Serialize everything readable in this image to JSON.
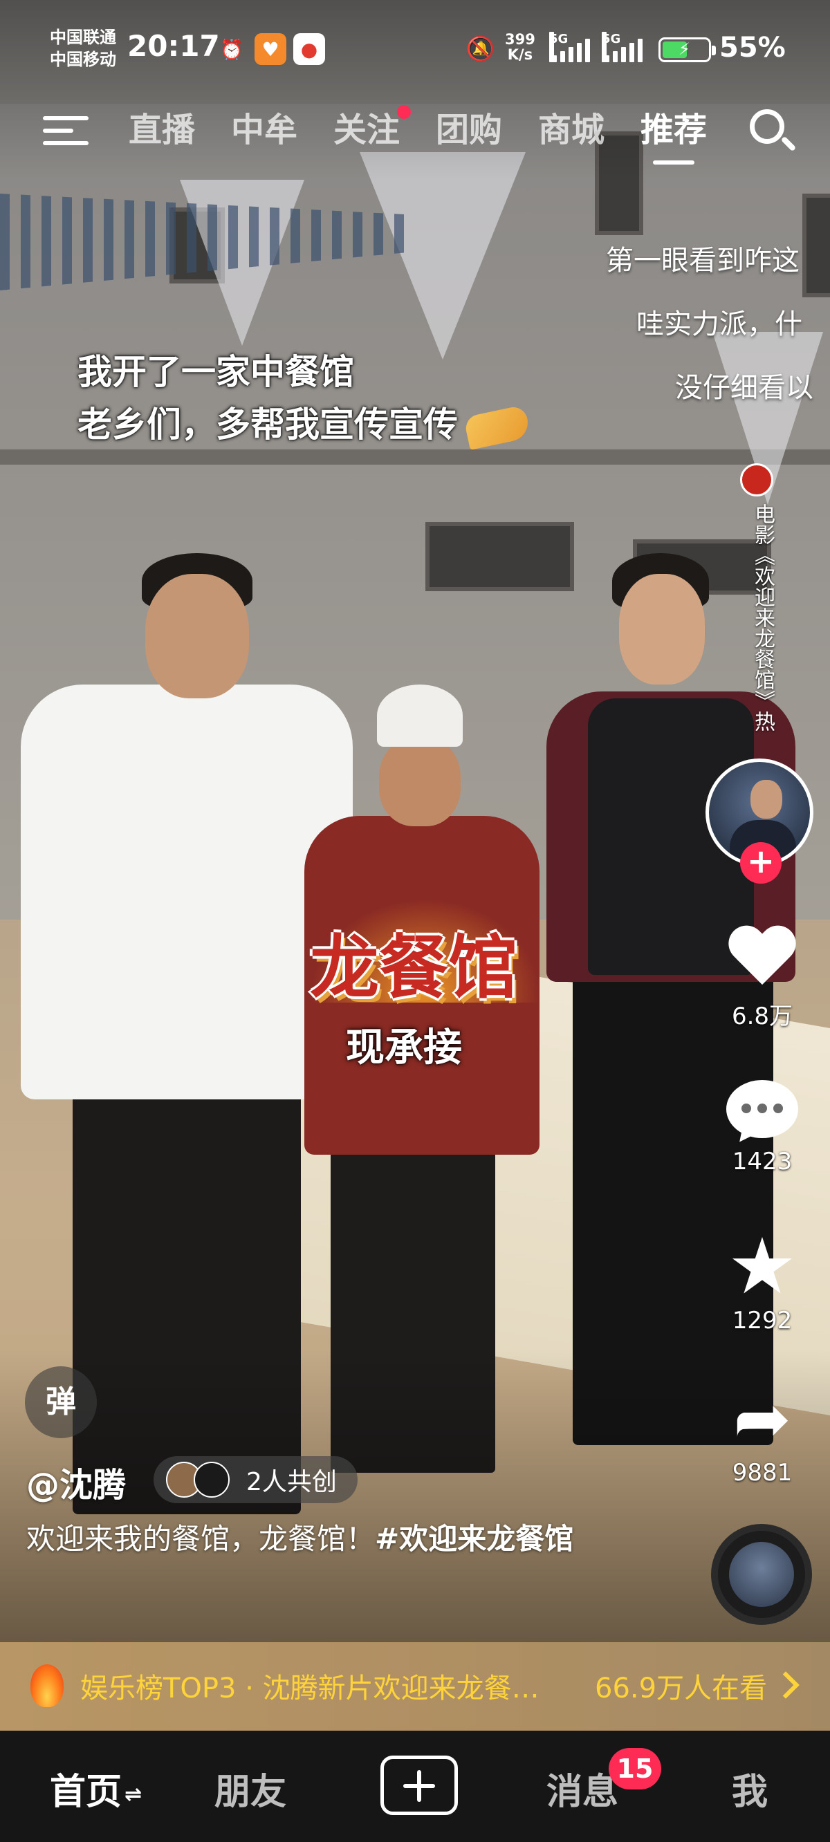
{
  "status_bar": {
    "carrier_1": "中国联通",
    "carrier_2": "中国移动",
    "time": "20:17",
    "net_speed_value": "399",
    "net_speed_unit": "K/s",
    "signal_1_label": "5G",
    "signal_2_label": "5G",
    "battery_percent": "55%",
    "battery_level": 0.55,
    "icons": [
      "alarm-icon",
      "health-app-icon",
      "piggy-app-icon",
      "mute-bell-icon"
    ]
  },
  "top_nav": {
    "tabs": [
      {
        "label": "直播",
        "active": false
      },
      {
        "label": "中牟",
        "active": false
      },
      {
        "label": "关注",
        "active": false,
        "dot": true
      },
      {
        "label": "团购",
        "active": false
      },
      {
        "label": "商城",
        "active": false
      },
      {
        "label": "推荐",
        "active": true
      }
    ]
  },
  "danmaku": [
    "第一眼看到咋这",
    "哇实力派，什",
    "没仔细看以"
  ],
  "caption": {
    "line_1": "我开了一家中餐馆",
    "line_2": "老乡们，多帮我宣传宣传"
  },
  "movie_tag": "电影《欢迎来龙餐馆》热",
  "overlay": {
    "title": "龙餐馆",
    "subtitle": "现承接"
  },
  "actions": {
    "likes": "6.8万",
    "comments": "1423",
    "favorites": "1292",
    "shares": "9881"
  },
  "danmaku_toggle": "弹",
  "author": "@沈腾",
  "co_create": "2人共创",
  "description": {
    "text": "欢迎来我的餐馆，龙餐馆！",
    "hashtag": "#欢迎来龙餐馆"
  },
  "hot_banner": {
    "text": "娱乐榜TOP3 · 沈腾新片欢迎来龙餐…",
    "watching": "66.9万人在看"
  },
  "bottom_nav": {
    "home": "首页",
    "friends": "朋友",
    "messages": "消息",
    "messages_badge": "15",
    "me": "我"
  },
  "colors": {
    "accent_red": "#fe2c55",
    "hot_yellow": "#ffd33a",
    "battery_green": "#4cd964"
  }
}
